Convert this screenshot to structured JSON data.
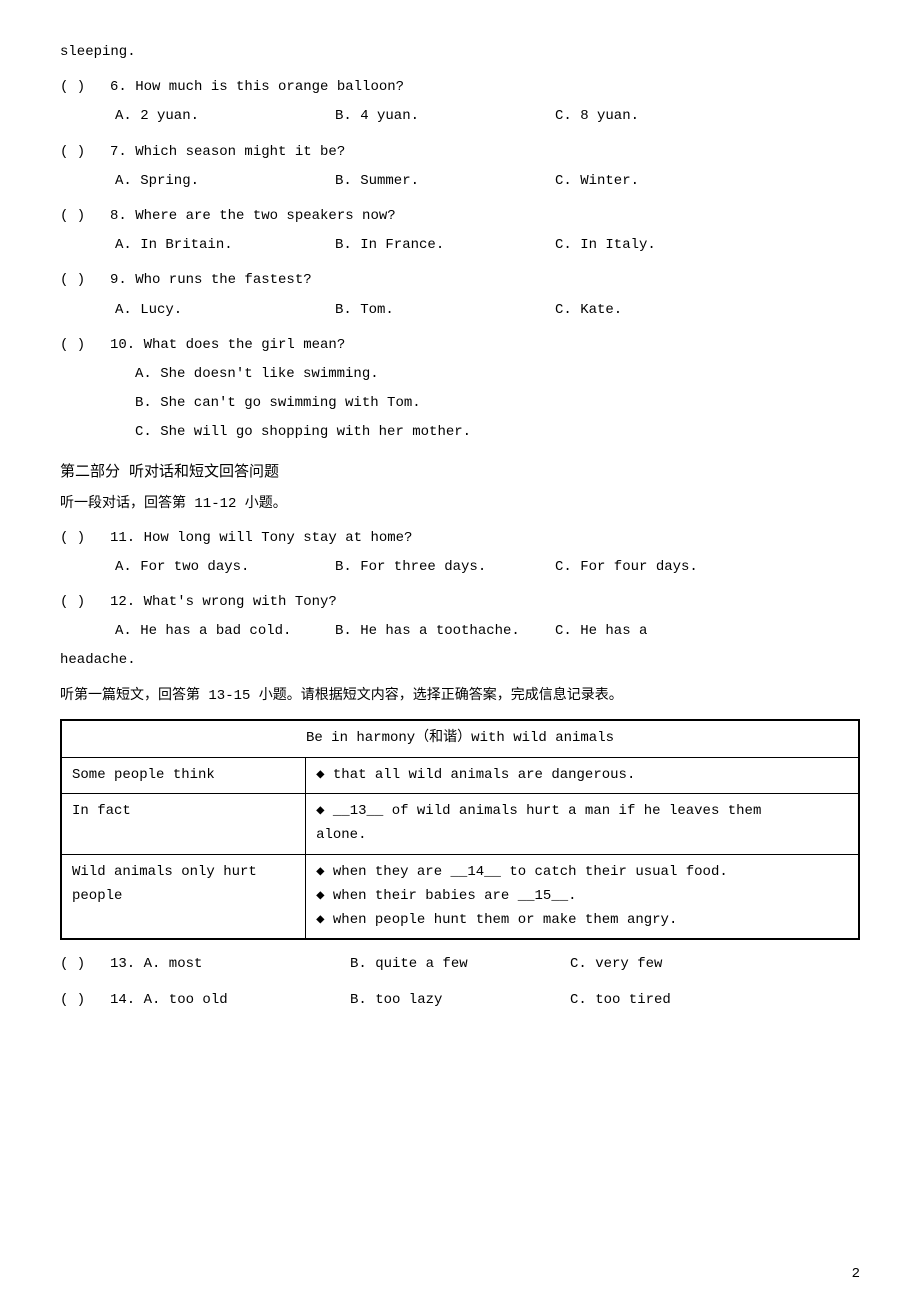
{
  "intro": {
    "sleeping": "sleeping."
  },
  "questions": [
    {
      "id": "q6",
      "paren": "(    )",
      "text": "6. How much is this orange balloon?",
      "options": [
        "A. 2 yuan.",
        "B. 4 yuan.",
        "C. 8 yuan."
      ]
    },
    {
      "id": "q7",
      "paren": "(    )",
      "text": "7. Which season might it be?",
      "options": [
        "A. Spring.",
        "B. Summer.",
        "C. Winter."
      ]
    },
    {
      "id": "q8",
      "paren": "(    )",
      "text": "8. Where are the two speakers now?",
      "options": [
        "A. In Britain.",
        "B. In France.",
        "C. In Italy."
      ]
    },
    {
      "id": "q9",
      "paren": "(    )",
      "text": "9. Who runs the fastest?",
      "options": [
        "A. Lucy.",
        "B. Tom.",
        "C. Kate."
      ]
    }
  ],
  "q10": {
    "paren": "(    )",
    "text": "10. What does the girl mean?",
    "options": [
      "A. She doesn't like swimming.",
      "B. She can't go swimming with Tom.",
      "C. She will go shopping with her mother."
    ]
  },
  "section2": {
    "title": "第二部分  听对话和短文回答问题",
    "subtitle": "听一段对话，回答第 11-12 小题。"
  },
  "q11": {
    "paren": "(    )",
    "text": "11. How long will Tony stay at home?",
    "options": [
      "A. For two days.",
      "B. For three days.",
      "C. For four days."
    ]
  },
  "q12": {
    "paren": "(    )",
    "text": "12. What's wrong with Tony?",
    "options_part1": [
      "A. He has a bad cold.",
      "B. He has a toothache.",
      "C. He has a"
    ],
    "options_part2": "headache."
  },
  "passage_intro": "听第一篇短文，回答第 13-15 小题。请根据短文内容，选择正确答案，完成信息记录表。",
  "table": {
    "header": "Be in harmony（和谐）with wild animals",
    "rows": [
      {
        "col1": "Some people think",
        "col2": "◆  that all wild animals are dangerous."
      },
      {
        "col1": "In fact",
        "col2_line1": "◆  __13__ of wild animals hurt a man if he leaves them",
        "col2_line2": "alone."
      },
      {
        "col1_line1": "Wild  animals  only  hurt",
        "col1_line2": "people",
        "col2_lines": [
          "◆  when they are __14__ to catch their usual food.",
          "◆  when their babies are __15__.",
          "◆  when people hunt them or make them angry."
        ]
      }
    ]
  },
  "q13": {
    "paren": "(    )",
    "text": "13. A. most",
    "optionB": "B. quite a few",
    "optionC": "C. very few"
  },
  "q14": {
    "paren": "(    )",
    "text": "14. A. too old",
    "optionB": "B. too lazy",
    "optionC": "C. too tired"
  },
  "page_number": "2"
}
